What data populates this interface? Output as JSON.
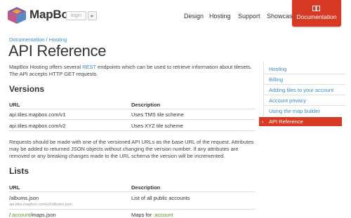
{
  "header": {
    "logo_text": "MapBox",
    "login_label": "login",
    "login_arrow": "▸",
    "nav": [
      {
        "label": "Design"
      },
      {
        "label": "Hosting"
      },
      {
        "label": "Support"
      },
      {
        "label": "Showcase"
      }
    ],
    "nav_active": {
      "label": "Documentation",
      "icon": "book-icon"
    },
    "accent_color": "#d63a24"
  },
  "breadcrumb": "Documentation / Hosting",
  "page_title": "API Reference",
  "intro": {
    "before": "MapBox Hosting offers several ",
    "link": "REST",
    "after": " endpoints which can be used to retrieve information about tilesets. The API accepts HTTP GET requests."
  },
  "versions": {
    "heading": "Versions",
    "columns": [
      "URL",
      "Description"
    ],
    "rows": [
      {
        "url": "api.tiles.mapbox.com/v1",
        "description": "Uses TMS tile scheme"
      },
      {
        "url": "api.tiles.mapbox.com/v2",
        "description": "Uses XYZ tile scheme"
      }
    ]
  },
  "paragraph": "Requests should be made with one of the versioned API URLs as the base URL of the request. Attributes may be added to returned JSON objects without changing the version number. If any attributes are removed or any breaking changes made to the URL schema the version will be incremented.",
  "lists": {
    "heading": "Lists",
    "columns": [
      "URL",
      "Description"
    ],
    "rows": [
      {
        "url": "/albums.json",
        "example": "api.tiles.mapbox.com/v2/albums.json",
        "description": "List of all public accounts"
      },
      {
        "url_prefix": "/",
        "url_var": ":account",
        "url_suffix": "/maps.json",
        "description_prefix": "Maps for ",
        "description_var": ":account"
      }
    ]
  },
  "sidebar": {
    "items": [
      {
        "label": "Hosting"
      },
      {
        "label": "Billing"
      },
      {
        "label": "Adding tiles to your account"
      },
      {
        "label": "Account privacy"
      },
      {
        "label": "Using the map builder"
      }
    ],
    "active": {
      "label": "API Reference",
      "arrow": "‹"
    }
  }
}
